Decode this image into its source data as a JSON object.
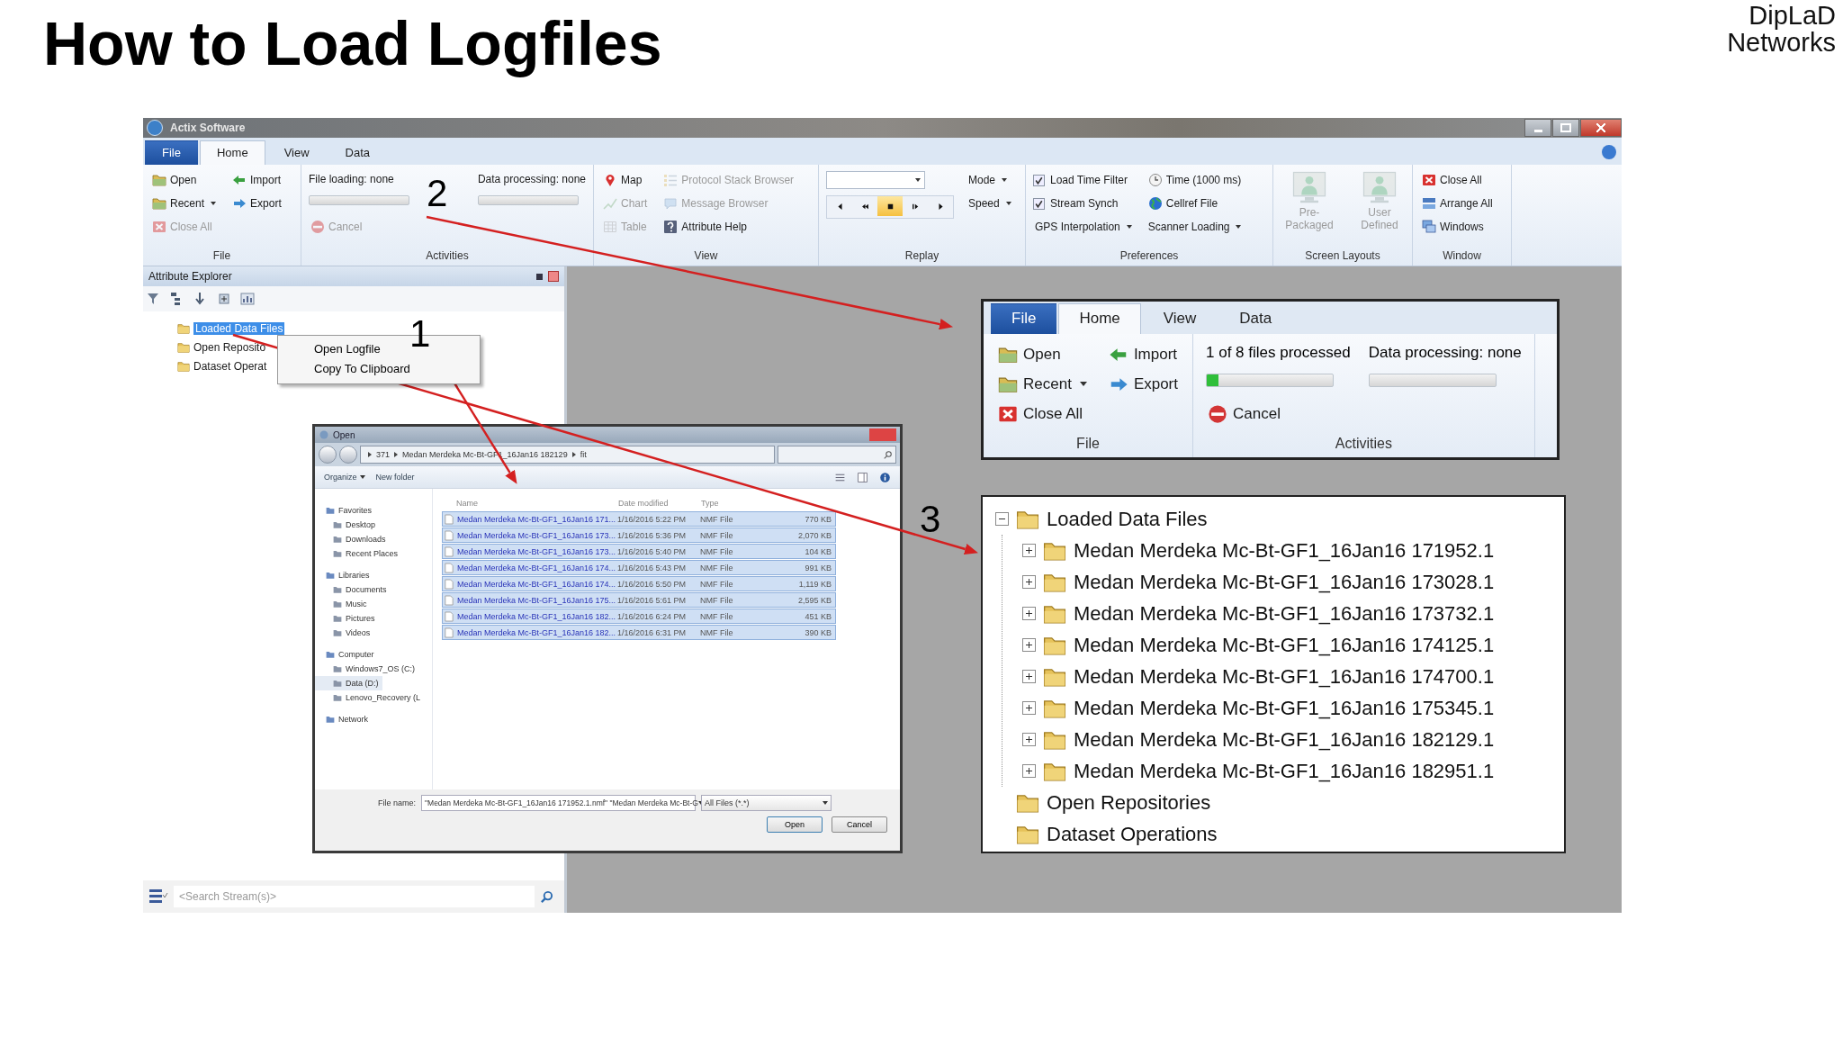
{
  "slide": {
    "title": "How to Load Logfiles",
    "brand": [
      "DipLaD",
      "Networks"
    ]
  },
  "app": {
    "title": "Actix Software",
    "tabs": [
      {
        "label": "File",
        "kind": "file",
        "selected": false
      },
      {
        "label": "Home",
        "kind": "tab",
        "selected": true
      },
      {
        "label": "View",
        "kind": "tab",
        "selected": false
      },
      {
        "label": "Data",
        "kind": "tab",
        "selected": false
      }
    ],
    "ribbon": [
      {
        "label": "File",
        "columns": [
          [
            {
              "kind": "button",
              "label": "Open",
              "disabled": false
            },
            {
              "kind": "menubutton",
              "label": "Recent",
              "disabled": false
            },
            {
              "kind": "button",
              "label": "Close All",
              "disabled": true
            }
          ],
          [
            {
              "kind": "button",
              "label": "Import",
              "disabled": false
            },
            {
              "kind": "button",
              "label": "Export",
              "disabled": false
            }
          ]
        ]
      },
      {
        "label": "Activities",
        "columns": [
          [
            {
              "kind": "progress",
              "label": "File loading: none",
              "level": 0
            },
            {
              "kind": "button",
              "label": "Cancel",
              "disabled": true
            }
          ],
          [
            {
              "kind": "progress",
              "label": "Data processing: none",
              "level": 0
            }
          ]
        ]
      },
      {
        "label": "View",
        "columns": [
          [
            {
              "kind": "button",
              "label": "Map",
              "disabled": false
            },
            {
              "kind": "button",
              "label": "Chart",
              "disabled": true
            },
            {
              "kind": "button",
              "label": "Table",
              "disabled": true
            }
          ],
          [
            {
              "kind": "button",
              "label": "Protocol Stack Browser",
              "disabled": true
            },
            {
              "kind": "button",
              "label": "Message Browser",
              "disabled": true
            },
            {
              "kind": "button",
              "label": "Attribute Help",
              "disabled": false
            }
          ]
        ]
      },
      {
        "label": "Replay",
        "columns": [
          [
            {
              "kind": "combo"
            },
            {
              "kind": "media",
              "buttons": [
                {
                  "selected": false
                },
                {
                  "selected": false
                },
                {
                  "selected": true
                },
                {
                  "selected": false
                },
                {
                  "selected": false
                }
              ]
            }
          ],
          [
            {
              "kind": "menubutton",
              "label": "Mode",
              "disabled": false
            },
            {
              "kind": "menubutton",
              "label": "Speed",
              "disabled": false
            }
          ]
        ]
      },
      {
        "label": "Preferences",
        "columns": [
          [
            {
              "kind": "checkbox",
              "label": "Load Time Filter",
              "checked": true
            },
            {
              "kind": "checkbox",
              "label": "Stream Synch",
              "checked": true
            },
            {
              "kind": "menubutton",
              "label": "GPS Interpolation",
              "disabled": false
            }
          ],
          [
            {
              "kind": "button",
              "label": "Time (1000 ms)",
              "disabled": false
            },
            {
              "kind": "button",
              "label": "Cellref File",
              "disabled": false
            },
            {
              "kind": "menubutton",
              "label": "Scanner Loading",
              "disabled": false
            }
          ]
        ]
      },
      {
        "label": "Screen Layouts",
        "columns": [
          [
            {
              "kind": "large",
              "label": "Pre-Packaged",
              "disabled": true
            }
          ],
          [
            {
              "kind": "large",
              "label": "User Defined",
              "disabled": true
            }
          ]
        ]
      },
      {
        "label": "Window",
        "columns": [
          [
            {
              "kind": "button",
              "label": "Close All",
              "disabled": false
            },
            {
              "kind": "button",
              "label": "Arrange All",
              "disabled": false
            },
            {
              "kind": "button",
              "label": "Windows",
              "disabled": false
            }
          ]
        ]
      }
    ],
    "explorer": {
      "title": "Attribute Explorer",
      "tree": [
        {
          "label": "Loaded Data Files",
          "selected": true
        },
        {
          "label": "Open Reposito",
          "selected": false
        },
        {
          "label": "Dataset Operat",
          "selected": false
        }
      ],
      "search": {
        "placeholder": "<Search Stream(s)>"
      }
    }
  },
  "context_menu": [
    "Open Logfile",
    "Copy To Clipboard"
  ],
  "open_dialog": {
    "title": "Open",
    "breadcrumb": [
      "371",
      "Medan Merdeka Mc-Bt-GF1_16Jan16 182129",
      "fit"
    ],
    "toolbar": [
      "Organize",
      "New folder"
    ],
    "nav": [
      {
        "label": "Favorites",
        "kind": "group",
        "selected": false
      },
      {
        "label": "Desktop",
        "kind": "item",
        "selected": false
      },
      {
        "label": "Downloads",
        "kind": "item",
        "selected": false
      },
      {
        "label": "Recent Places",
        "kind": "item",
        "selected": false
      },
      {
        "label": "Libraries",
        "kind": "group",
        "selected": false
      },
      {
        "label": "Documents",
        "kind": "item",
        "selected": false
      },
      {
        "label": "Music",
        "kind": "item",
        "selected": false
      },
      {
        "label": "Pictures",
        "kind": "item",
        "selected": false
      },
      {
        "label": "Videos",
        "kind": "item",
        "selected": false
      },
      {
        "label": "Computer",
        "kind": "group",
        "selected": false
      },
      {
        "label": "Windows7_OS (C:)",
        "kind": "item",
        "selected": false
      },
      {
        "label": "Data (D:)",
        "kind": "item",
        "selected": true
      },
      {
        "label": "Lenovo_Recovery (L",
        "kind": "item",
        "selected": false
      },
      {
        "label": "Network",
        "kind": "group",
        "selected": false
      }
    ],
    "columns": [
      "Name",
      "Date modified",
      "Type"
    ],
    "files": [
      {
        "name": "Medan Merdeka Mc-Bt-GF1_16Jan16 171...",
        "date": "1/16/2016 5:22 PM",
        "type": "NMF File",
        "size": "770 KB",
        "selected": true
      },
      {
        "name": "Medan Merdeka Mc-Bt-GF1_16Jan16 173...",
        "date": "1/16/2016 5:36 PM",
        "type": "NMF File",
        "size": "2,070 KB",
        "selected": true
      },
      {
        "name": "Medan Merdeka Mc-Bt-GF1_16Jan16 173...",
        "date": "1/16/2016 5:40 PM",
        "type": "NMF File",
        "size": "104 KB",
        "selected": true
      },
      {
        "name": "Medan Merdeka Mc-Bt-GF1_16Jan16 174...",
        "date": "1/16/2016 5:43 PM",
        "type": "NMF File",
        "size": "991 KB",
        "selected": true
      },
      {
        "name": "Medan Merdeka Mc-Bt-GF1_16Jan16 174...",
        "date": "1/16/2016 5:50 PM",
        "type": "NMF File",
        "size": "1,119 KB",
        "selected": true
      },
      {
        "name": "Medan Merdeka Mc-Bt-GF1_16Jan16 175...",
        "date": "1/16/2016 5:61 PM",
        "type": "NMF File",
        "size": "2,595 KB",
        "selected": true
      },
      {
        "name": "Medan Merdeka Mc-Bt-GF1_16Jan16 182...",
        "date": "1/16/2016 6:24 PM",
        "type": "NMF File",
        "size": "451 KB",
        "selected": true
      },
      {
        "name": "Medan Merdeka Mc-Bt-GF1_16Jan16 182...",
        "date": "1/16/2016 6:31 PM",
        "type": "NMF File",
        "size": "390 KB",
        "selected": true
      }
    ],
    "file_name_label": "File name:",
    "file_name": "\"Medan Merdeka Mc-Bt-GF1_16Jan16 171952.1.nmf\" \"Medan Merdeka Mc-Bt-G",
    "filter": "All Files (*.*)",
    "buttons": [
      "Open",
      "Cancel"
    ]
  },
  "ribbon_inset": {
    "tabs": [
      {
        "label": "File",
        "kind": "file",
        "selected": false
      },
      {
        "label": "Home",
        "kind": "tab",
        "selected": true
      },
      {
        "label": "View",
        "kind": "tab",
        "selected": false
      },
      {
        "label": "Data",
        "kind": "tab",
        "selected": false
      }
    ],
    "groups": [
      {
        "label": "File",
        "columns": [
          [
            {
              "kind": "button",
              "label": "Open",
              "disabled": false
            },
            {
              "kind": "menubutton",
              "label": "Recent",
              "disabled": false
            },
            {
              "kind": "button",
              "label": "Close All",
              "disabled": false
            }
          ],
          [
            {
              "kind": "button",
              "label": "Import",
              "disabled": false
            },
            {
              "kind": "button",
              "label": "Export",
              "disabled": false
            }
          ]
        ]
      },
      {
        "label": "Activities",
        "columns": [
          [
            {
              "kind": "progress",
              "label": "1 of 8 files processed",
              "level": 0.09
            },
            {
              "kind": "button",
              "label": "Cancel",
              "disabled": false
            }
          ],
          [
            {
              "kind": "progress",
              "label": "Data processing: none",
              "level": 0
            }
          ]
        ]
      }
    ]
  },
  "tree_inset": {
    "tree": [
      {
        "label": "Loaded Data Files",
        "expanded": true,
        "children": [
          {
            "label": "Medan Merdeka Mc-Bt-GF1_16Jan16 171952.1",
            "expanded": false
          },
          {
            "label": "Medan Merdeka Mc-Bt-GF1_16Jan16 173028.1",
            "expanded": false
          },
          {
            "label": "Medan Merdeka Mc-Bt-GF1_16Jan16 173732.1",
            "expanded": false
          },
          {
            "label": "Medan Merdeka Mc-Bt-GF1_16Jan16 174125.1",
            "expanded": false
          },
          {
            "label": "Medan Merdeka Mc-Bt-GF1_16Jan16 174700.1",
            "expanded": false
          },
          {
            "label": "Medan Merdeka Mc-Bt-GF1_16Jan16 175345.1",
            "expanded": false
          },
          {
            "label": "Medan Merdeka Mc-Bt-GF1_16Jan16 182129.1",
            "expanded": false
          },
          {
            "label": "Medan Merdeka Mc-Bt-GF1_16Jan16 182951.1",
            "expanded": false
          }
        ]
      },
      {
        "label": "Open Repositories"
      },
      {
        "label": "Dataset Operations"
      }
    ]
  },
  "callouts": [
    "1",
    "2",
    "3"
  ]
}
